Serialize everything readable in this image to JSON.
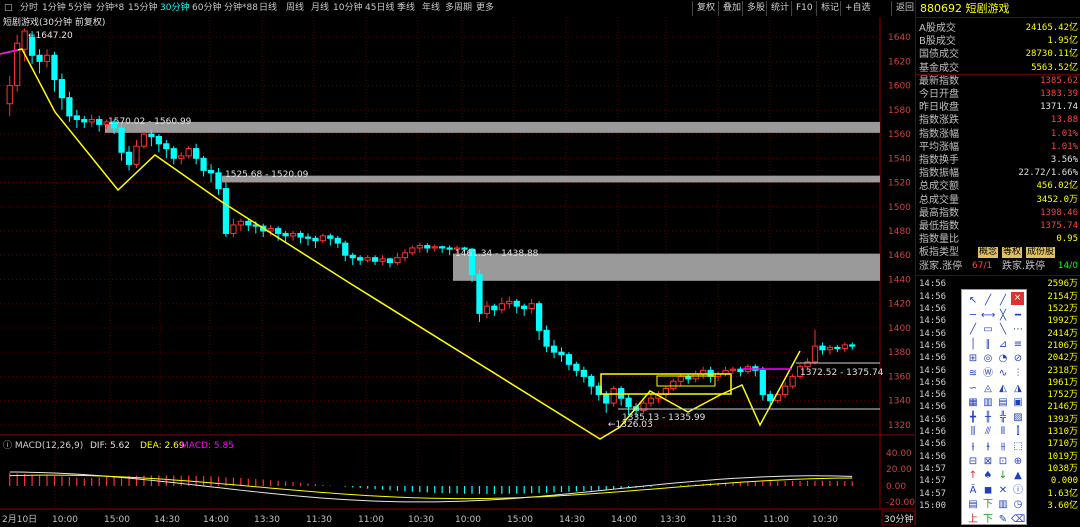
{
  "periods": [
    {
      "label": "分时",
      "active": false
    },
    {
      "label": "1分钟",
      "active": false
    },
    {
      "label": "5分钟",
      "active": false
    },
    {
      "label": "分钟*8",
      "active": false
    },
    {
      "label": "15分钟",
      "active": false
    },
    {
      "label": "30分钟",
      "active": true
    },
    {
      "label": "60分钟",
      "active": false
    },
    {
      "label": "分钟*88",
      "active": false
    },
    {
      "label": "日线",
      "active": false
    },
    {
      "label": "周线",
      "active": false
    },
    {
      "label": "月线",
      "active": false
    },
    {
      "label": "10分钟",
      "active": false
    },
    {
      "label": "45日线",
      "active": false
    },
    {
      "label": "季线",
      "active": false
    },
    {
      "label": "年线",
      "active": false
    },
    {
      "label": "多周期",
      "active": false
    },
    {
      "label": "更多",
      "active": false
    }
  ],
  "toolbar": [
    "复权",
    "叠加",
    "多股",
    "统计",
    "F10",
    "标记",
    "+自选",
    "返回"
  ],
  "chart_title": "短剧游戏(30分钟 前复权)",
  "y_labels": [
    "1640",
    "1620",
    "1600",
    "1580",
    "1560",
    "1540",
    "1520",
    "1500",
    "1480",
    "1460",
    "1440",
    "1420",
    "1400",
    "1380",
    "1360",
    "1340",
    "1320"
  ],
  "annotations": {
    "high": "1647.20",
    "z1": "1570.02 - 1560.99",
    "z2": "1525.68 - 1520.09",
    "z3": "1461.34 - 1438.88",
    "low": "1326.03",
    "z4": "1335.13 - 1335.99",
    "z5": "1372.52 - 1375.74"
  },
  "macd": {
    "label": "MACD(12,26,9)",
    "dif": "DIF: 5.62",
    "dea": "DEA: 2.69",
    "macd": "MACD: 5.85",
    "y_labels": [
      "40.00",
      "20.00",
      "0.00",
      "-20.00"
    ]
  },
  "x_labels": [
    "2月10日",
    "10:00",
    "15:00",
    "14:30",
    "14:00",
    "13:30",
    "11:30",
    "11:00",
    "10:30",
    "10:00",
    "15:00",
    "14:30",
    "14:00",
    "13:30",
    "11:30",
    "11:00",
    "10:30"
  ],
  "period_badge": "30分钟",
  "stock_code": "880692 短剧游戏",
  "stats": [
    {
      "label": "A股成交",
      "value": "24165.42亿",
      "color": "#ffff00"
    },
    {
      "label": "B股成交",
      "value": "1.95亿",
      "color": "#ffff00"
    },
    {
      "label": "国债成交",
      "value": "28730.11亿",
      "color": "#ffff00"
    },
    {
      "label": "基金成交",
      "value": "5563.52亿",
      "color": "#ffff00"
    },
    {
      "label": "最新指数",
      "value": "1385.62",
      "color": "#ff4040"
    },
    {
      "label": "今日开盘",
      "value": "1383.39",
      "color": "#ff4040"
    },
    {
      "label": "昨日收盘",
      "value": "1371.74",
      "color": "#e0e0e0"
    },
    {
      "label": "指数涨跌",
      "value": "13.88",
      "color": "#ff4040"
    },
    {
      "label": "指数涨幅",
      "value": "1.01%",
      "color": "#ff4040"
    },
    {
      "label": "平均涨幅",
      "value": "1.01%",
      "color": "#ff4040"
    },
    {
      "label": "指数换手",
      "value": "3.56%",
      "color": "#e0e0e0"
    },
    {
      "label": "指数振幅",
      "value": "22.72/1.66%",
      "color": "#e0e0e0"
    },
    {
      "label": "总成交额",
      "value": "456.02亿",
      "color": "#ffff00"
    },
    {
      "label": "总成交量",
      "value": "3452.0万",
      "color": "#ffff00"
    },
    {
      "label": "最高指数",
      "value": "1398.46",
      "color": "#ff4040"
    },
    {
      "label": "最低指数",
      "value": "1375.74",
      "color": "#ff4040"
    },
    {
      "label": "指数量比",
      "value": "0.95",
      "color": "#ffff00"
    }
  ],
  "board": {
    "label": "板指类型",
    "tags": [
      "概念",
      "等权",
      "成份股"
    ]
  },
  "updown": {
    "label": "涨家.涨停",
    "value": "67/1",
    "label2": "跌家.跌停",
    "value2": "14/0"
  },
  "ticks": [
    {
      "t": "14:56",
      "v": "2596万"
    },
    {
      "t": "14:56",
      "v": "2154万"
    },
    {
      "t": "14:56",
      "v": "1522万"
    },
    {
      "t": "14:56",
      "v": "1992万"
    },
    {
      "t": "14:56",
      "v": "2414万"
    },
    {
      "t": "14:56",
      "v": "2106万"
    },
    {
      "t": "14:56",
      "v": "2042万"
    },
    {
      "t": "14:56",
      "v": "2318万"
    },
    {
      "t": "14:56",
      "v": "1961万"
    },
    {
      "t": "14:56",
      "v": "1752万"
    },
    {
      "t": "14:56",
      "v": "2146万"
    },
    {
      "t": "14:56",
      "v": "1393万"
    },
    {
      "t": "14:56",
      "v": "1310万"
    },
    {
      "t": "14:56",
      "v": "1710万"
    },
    {
      "t": "14:56",
      "v": "1019万"
    },
    {
      "t": "14:57",
      "v": "1038万"
    },
    {
      "t": "14:57",
      "v": "0.000"
    },
    {
      "t": "14:57",
      "v": "1.63亿"
    },
    {
      "t": "15:00",
      "v": "3.60亿"
    }
  ],
  "colors": {
    "up": "#ff3030",
    "down": "#00ffff",
    "trend": "#ffff00",
    "zone": "#9a9a9a",
    "panel_border": "#6b0000"
  },
  "drawtools": {
    "close_label": "×"
  },
  "chart_data": {
    "type": "candlestick",
    "price_range": [
      1310,
      1650
    ],
    "candles": [
      [
        1585,
        1600,
        1575,
        1608
      ],
      [
        1600,
        1635,
        1595,
        1642
      ],
      [
        1630,
        1645,
        1620,
        1647.2
      ],
      [
        1640,
        1625,
        1618,
        1645
      ],
      [
        1625,
        1620,
        1610,
        1630
      ],
      [
        1620,
        1625,
        1615,
        1630
      ],
      [
        1625,
        1605,
        1595,
        1628
      ],
      [
        1605,
        1590,
        1580,
        1610
      ],
      [
        1590,
        1575,
        1570,
        1595
      ],
      [
        1575,
        1572,
        1565,
        1580
      ],
      [
        1572,
        1570,
        1565,
        1575
      ],
      [
        1570,
        1572,
        1566,
        1576
      ],
      [
        1572,
        1568,
        1562,
        1575
      ],
      [
        1568,
        1570,
        1564,
        1572
      ],
      [
        1570,
        1565,
        1560,
        1572
      ],
      [
        1565,
        1545,
        1538,
        1568
      ],
      [
        1545,
        1535,
        1530,
        1550
      ],
      [
        1535,
        1550,
        1532,
        1555
      ],
      [
        1550,
        1560,
        1548,
        1562
      ],
      [
        1560,
        1558,
        1550,
        1563
      ],
      [
        1558,
        1552,
        1545,
        1560
      ],
      [
        1552,
        1548,
        1540,
        1555
      ],
      [
        1548,
        1540,
        1535,
        1550
      ],
      [
        1540,
        1542,
        1535,
        1545
      ],
      [
        1542,
        1548,
        1540,
        1550
      ],
      [
        1548,
        1540,
        1535,
        1552
      ],
      [
        1540,
        1530,
        1525,
        1542
      ],
      [
        1530,
        1528,
        1520,
        1535
      ],
      [
        1528,
        1515,
        1510,
        1532
      ],
      [
        1515,
        1478,
        1475,
        1520
      ],
      [
        1478,
        1485,
        1475,
        1490
      ],
      [
        1485,
        1488,
        1480,
        1490
      ],
      [
        1488,
        1485,
        1480,
        1490
      ],
      [
        1485,
        1484,
        1478,
        1488
      ],
      [
        1484,
        1480,
        1475,
        1486
      ],
      [
        1480,
        1482,
        1476,
        1485
      ],
      [
        1482,
        1478,
        1472,
        1484
      ],
      [
        1478,
        1476,
        1470,
        1480
      ],
      [
        1476,
        1478,
        1472,
        1480
      ],
      [
        1478,
        1475,
        1470,
        1480
      ],
      [
        1475,
        1474,
        1468,
        1478
      ],
      [
        1474,
        1472,
        1466,
        1476
      ],
      [
        1472,
        1476,
        1470,
        1478
      ],
      [
        1476,
        1474,
        1468,
        1478
      ],
      [
        1474,
        1470,
        1466,
        1476
      ],
      [
        1470,
        1460,
        1455,
        1472
      ],
      [
        1460,
        1458,
        1452,
        1462
      ],
      [
        1458,
        1456,
        1452,
        1460
      ],
      [
        1456,
        1458,
        1454,
        1460
      ],
      [
        1458,
        1455,
        1452,
        1460
      ],
      [
        1455,
        1457,
        1452,
        1460
      ],
      [
        1457,
        1454,
        1450,
        1458
      ],
      [
        1454,
        1458,
        1452,
        1462
      ],
      [
        1458,
        1462,
        1455,
        1465
      ],
      [
        1462,
        1466,
        1460,
        1468
      ],
      [
        1466,
        1468,
        1462,
        1470
      ],
      [
        1468,
        1466,
        1462,
        1470
      ],
      [
        1466,
        1467,
        1463,
        1469
      ],
      [
        1467,
        1466,
        1462,
        1468
      ],
      [
        1466,
        1465,
        1460,
        1468
      ],
      [
        1465,
        1466,
        1461,
        1468
      ],
      [
        1466,
        1465,
        1462,
        1467
      ],
      [
        1465,
        1444,
        1438,
        1466
      ],
      [
        1444,
        1412,
        1405,
        1448
      ],
      [
        1412,
        1418,
        1408,
        1422
      ],
      [
        1418,
        1415,
        1410,
        1420
      ],
      [
        1415,
        1420,
        1412,
        1425
      ],
      [
        1420,
        1422,
        1416,
        1426
      ],
      [
        1422,
        1418,
        1412,
        1424
      ],
      [
        1418,
        1416,
        1410,
        1420
      ],
      [
        1416,
        1420,
        1412,
        1424
      ],
      [
        1420,
        1398,
        1390,
        1422
      ],
      [
        1398,
        1385,
        1380,
        1402
      ],
      [
        1385,
        1380,
        1375,
        1390
      ],
      [
        1380,
        1378,
        1372,
        1384
      ],
      [
        1378,
        1370,
        1365,
        1380
      ],
      [
        1370,
        1365,
        1360,
        1372
      ],
      [
        1365,
        1360,
        1355,
        1368
      ],
      [
        1360,
        1352,
        1345,
        1362
      ],
      [
        1352,
        1345,
        1340,
        1355
      ],
      [
        1345,
        1338,
        1330,
        1348
      ],
      [
        1338,
        1350,
        1335,
        1352
      ],
      [
        1350,
        1342,
        1336,
        1352
      ],
      [
        1342,
        1335,
        1328,
        1345
      ],
      [
        1335,
        1332,
        1326.03,
        1338
      ],
      [
        1332,
        1338,
        1330,
        1340
      ],
      [
        1338,
        1342,
        1335,
        1345
      ],
      [
        1342,
        1345,
        1338,
        1348
      ],
      [
        1345,
        1350,
        1342,
        1352
      ],
      [
        1350,
        1356,
        1348,
        1358
      ],
      [
        1356,
        1360,
        1352,
        1362
      ],
      [
        1360,
        1358,
        1354,
        1362
      ],
      [
        1358,
        1362,
        1355,
        1365
      ],
      [
        1362,
        1365,
        1358,
        1368
      ],
      [
        1365,
        1360,
        1355,
        1368
      ],
      [
        1360,
        1362,
        1356,
        1364
      ],
      [
        1362,
        1365,
        1360,
        1368
      ],
      [
        1365,
        1366,
        1362,
        1368
      ],
      [
        1366,
        1364,
        1360,
        1368
      ],
      [
        1364,
        1368,
        1362,
        1370
      ],
      [
        1368,
        1365,
        1360,
        1370
      ],
      [
        1365,
        1345,
        1340,
        1368
      ],
      [
        1345,
        1340,
        1335,
        1348
      ],
      [
        1340,
        1345,
        1338,
        1348
      ],
      [
        1345,
        1352,
        1342,
        1355
      ],
      [
        1352,
        1360,
        1350,
        1362
      ],
      [
        1360,
        1368,
        1358,
        1370
      ],
      [
        1368,
        1372,
        1365,
        1375
      ],
      [
        1372,
        1385,
        1370,
        1398.46
      ],
      [
        1385,
        1382,
        1378,
        1388
      ],
      [
        1382,
        1384,
        1378,
        1386
      ],
      [
        1384,
        1383,
        1380,
        1386
      ],
      [
        1383,
        1386,
        1380,
        1388
      ],
      [
        1386,
        1385,
        1382,
        1388
      ]
    ]
  }
}
